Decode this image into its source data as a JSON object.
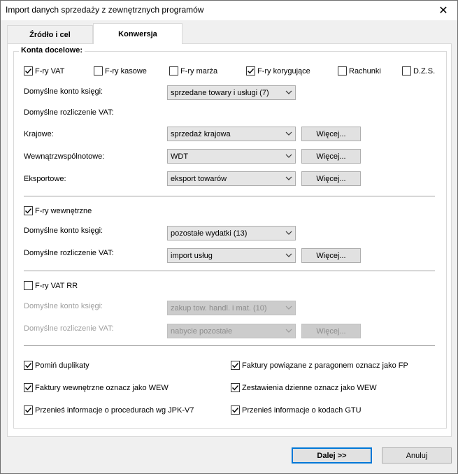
{
  "window": {
    "title": "Import danych sprzedaży z zewnętrznych programów",
    "close_label": "✕"
  },
  "tabs": [
    {
      "label": "Źródło i cel",
      "active": false
    },
    {
      "label": "Konwersja",
      "active": true
    }
  ],
  "group": {
    "title": "Konta docelowe:"
  },
  "doc_types": [
    {
      "label": "F-ry VAT",
      "checked": true
    },
    {
      "label": "F-ry kasowe",
      "checked": false
    },
    {
      "label": "F-ry marża",
      "checked": false
    },
    {
      "label": "F-ry korygujące",
      "checked": true
    },
    {
      "label": "Rachunki",
      "checked": false
    },
    {
      "label": "D.Z.S.",
      "checked": false
    }
  ],
  "section1": {
    "konto_label": "Domyślne konto księgi:",
    "konto_value": "sprzedane towary i usługi (7)",
    "vat_label": "Domyślne rozliczenie VAT:",
    "krajowe_label": "Krajowe:",
    "krajowe_value": "sprzedaż krajowa",
    "wew_label": "Wewnątrzwspólnotowe:",
    "wew_value": "WDT",
    "eksport_label": "Eksportowe:",
    "eksport_value": "eksport towarów",
    "more_label": "Więcej..."
  },
  "section2": {
    "checkbox_label": "F-ry wewnętrzne",
    "checked": true,
    "konto_label": "Domyślne konto księgi:",
    "konto_value": "pozostałe wydatki (13)",
    "vat_label": "Domyślne rozliczenie VAT:",
    "vat_value": "import usług",
    "more_label": "Więcej..."
  },
  "section3": {
    "checkbox_label": "F-ry VAT RR",
    "checked": false,
    "konto_label": "Domyślne konto księgi:",
    "konto_value": "zakup tow. handl. i mat. (10)",
    "vat_label": "Domyślne rozliczenie VAT:",
    "vat_value": "nabycie pozostałe",
    "more_label": "Więcej..."
  },
  "options": [
    {
      "label": "Pomiń duplikaty",
      "checked": true
    },
    {
      "label": "Faktury powiązane z paragonem oznacz jako FP",
      "checked": true
    },
    {
      "label": "Faktury wewnętrzne oznacz jako WEW",
      "checked": true
    },
    {
      "label": "Zestawienia dzienne oznacz jako WEW",
      "checked": true
    },
    {
      "label": "Przenieś informacje o procedurach wg JPK-V7",
      "checked": true
    },
    {
      "label": "Przenieś informacje o kodach GTU",
      "checked": true
    }
  ],
  "footer": {
    "next_label": "Dalej >>",
    "cancel_label": "Anuluj"
  }
}
